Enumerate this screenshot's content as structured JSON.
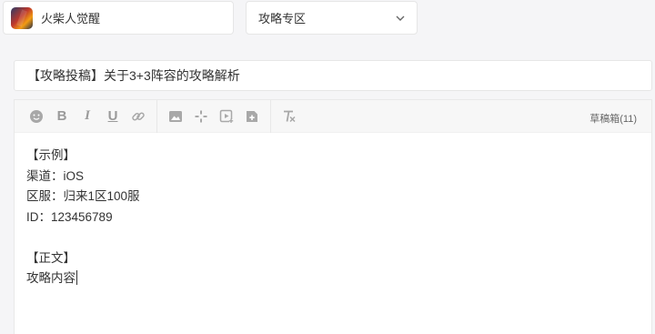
{
  "game_selector": {
    "name": "火柴人觉醒",
    "icon": "game-avatar-icon"
  },
  "category_selector": {
    "value": "攻略专区",
    "icon": "chevron-down-icon"
  },
  "title": {
    "value": "【攻略投稿】关于3+3阵容的攻略解析"
  },
  "toolbar": {
    "buttons": [
      {
        "name": "emoji",
        "icon": "emoji-icon"
      },
      {
        "name": "bold",
        "label": "B"
      },
      {
        "name": "italic",
        "label": "I"
      },
      {
        "name": "underline",
        "label": "U"
      },
      {
        "name": "link",
        "icon": "link-icon"
      },
      {
        "name": "image",
        "icon": "image-icon"
      },
      {
        "name": "sparkle",
        "icon": "sparkle-icon"
      },
      {
        "name": "video",
        "icon": "video-icon"
      },
      {
        "name": "file",
        "icon": "add-file-icon"
      },
      {
        "name": "clear-format",
        "icon": "clear-format-icon"
      }
    ],
    "drafts_label": "草稿箱(11)"
  },
  "body": {
    "lines": [
      "【示例】",
      "渠道：iOS",
      "区服：归来1区100服",
      "ID：123456789",
      "",
      "【正文】",
      "攻略内容"
    ]
  },
  "colors": {
    "background": "#f5f5f7",
    "toolbar_icon": "#9a9a9a",
    "text": "#333333"
  }
}
